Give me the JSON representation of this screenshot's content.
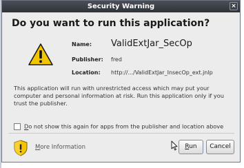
{
  "window": {
    "title": "Security Warning",
    "close_glyph": "×"
  },
  "heading": "Do you want to run this application?",
  "details": {
    "name_label": "Name:",
    "name_value": "ValidExtJar_SecOp",
    "publisher_label": "Publisher:",
    "publisher_value": "fred",
    "location_label": "Location:",
    "location_value": "http://.../ValidExtJar_InsecOp_ext.jnlp"
  },
  "message": "This application will run with unrestricted access which may put your computer and personal information at risk. Run this application only if you trust the publisher.",
  "checkbox": {
    "checked": false,
    "label_mnemonic": "D",
    "label_rest": "o not show this again for apps from the publisher and location above"
  },
  "more_info": {
    "mnemonic": "M",
    "rest": "ore Information"
  },
  "buttons": {
    "run_mnemonic": "R",
    "run_rest": "un",
    "cancel_label": "Cancel"
  },
  "icons": {
    "warning": "warning-triangle-icon",
    "shield": "shield-warning-icon",
    "cursor": "mouse-pointer-icon"
  },
  "colors": {
    "titlebar": "#2f3339",
    "warning_yellow": "#f2c500",
    "dialog_bg": "#ececec"
  }
}
